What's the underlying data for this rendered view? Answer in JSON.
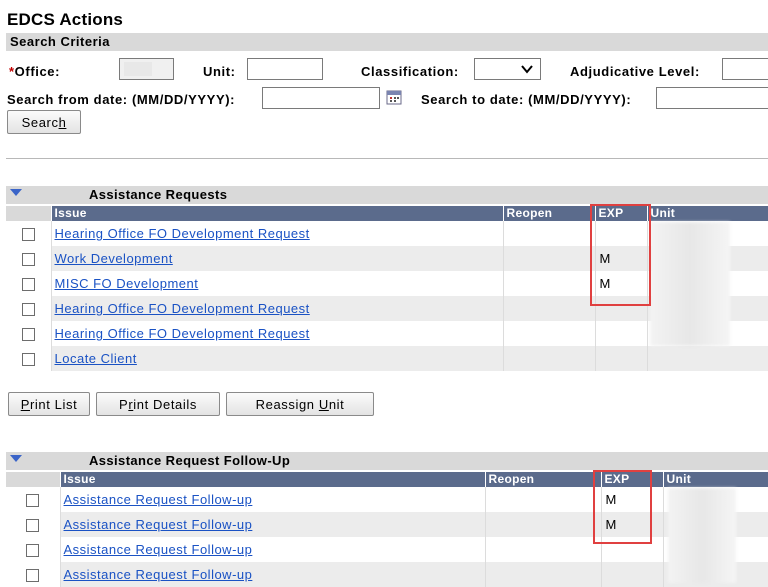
{
  "page": {
    "title": "EDCS Actions"
  },
  "search": {
    "header": "Search Criteria",
    "required_mark": "*",
    "office_label": "Office:",
    "office_value": "",
    "unit_label": "Unit:",
    "unit_value": "",
    "classification_label": "Classification:",
    "classification_value": "",
    "adjudicative_label": "Adjudicative Level:",
    "adjudicative_value": "",
    "from_date_label": "Search from date: (MM/DD/YYYY):",
    "from_date_value": "",
    "to_date_label": "Search to date: (MM/DD/YYYY):",
    "to_date_value": "",
    "search_button_pre": "Searc",
    "search_button_key": "h",
    "calendar_icon": "calendar-icon"
  },
  "assistance_requests": {
    "title": "Assistance Requests",
    "columns": {
      "issue": "Issue",
      "reopen": "Reopen",
      "exp": "EXP",
      "unit": "Unit"
    },
    "rows": [
      {
        "issue": "Hearing Office FO Development Request",
        "reopen": "",
        "exp": ""
      },
      {
        "issue": "Work Development",
        "reopen": "",
        "exp": "M"
      },
      {
        "issue": "MISC FO Development",
        "reopen": "",
        "exp": "M"
      },
      {
        "issue": "Hearing Office FO Development Request",
        "reopen": "",
        "exp": ""
      },
      {
        "issue": "Hearing Office FO Development Request",
        "reopen": "",
        "exp": ""
      },
      {
        "issue": "Locate Client",
        "reopen": "",
        "exp": ""
      }
    ]
  },
  "actions": {
    "print_list_key": "P",
    "print_list_rest": "rint List",
    "print_details_pre": "P",
    "print_details_key": "r",
    "print_details_rest": "int Details",
    "reassign_pre": "Reassign ",
    "reassign_key": "U",
    "reassign_rest": "nit"
  },
  "followup": {
    "title": "Assistance Request Follow-Up",
    "columns": {
      "issue": "Issue",
      "reopen": "Reopen",
      "exp": "EXP",
      "unit": "Unit"
    },
    "rows": [
      {
        "issue": "Assistance Request Follow-up",
        "reopen": "",
        "exp": "M"
      },
      {
        "issue": "Assistance Request Follow-up",
        "reopen": "",
        "exp": "M"
      },
      {
        "issue": "Assistance Request Follow-up",
        "reopen": "",
        "exp": ""
      },
      {
        "issue": "Assistance Request Follow-up",
        "reopen": "",
        "exp": ""
      }
    ]
  },
  "colors": {
    "header_blue": "#5b6b8c",
    "link_blue": "#1a52c4",
    "highlight_red": "#e04040",
    "bar_gray": "#d9d9d9"
  }
}
